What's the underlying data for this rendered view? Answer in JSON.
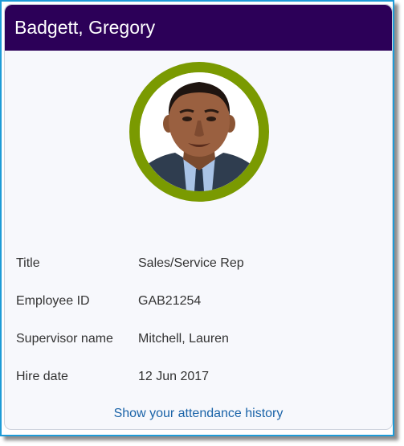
{
  "employee": {
    "name": "Badgett, Gregory",
    "photo": "employee-photo"
  },
  "details": [
    {
      "label": "Title",
      "value": "Sales/Service Rep"
    },
    {
      "label": "Employee ID",
      "value": "GAB21254"
    },
    {
      "label": "Supervisor name",
      "value": "Mitchell, Lauren"
    },
    {
      "label": "Hire date",
      "value": "12 Jun 2017"
    }
  ],
  "actions": {
    "attendance_link": "Show your attendance history"
  },
  "colors": {
    "header_bg": "#2c0058",
    "avatar_ring": "#7a9a01",
    "frame_border": "#1e9bd7",
    "link": "#1a63a8"
  }
}
